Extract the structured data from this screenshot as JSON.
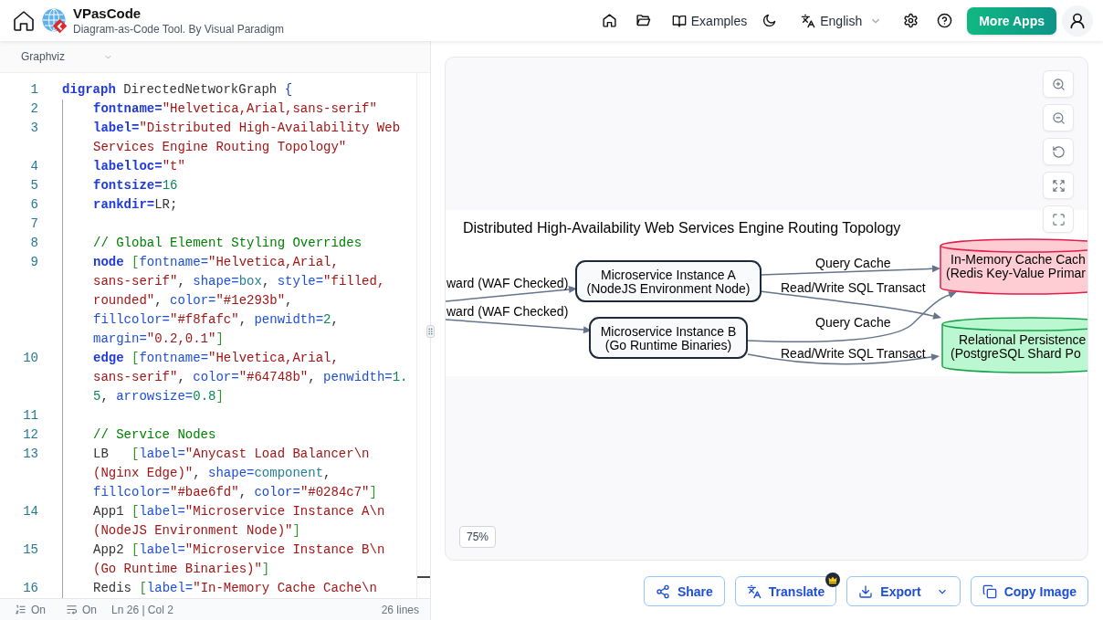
{
  "header": {
    "app_name": "VPasCode",
    "tagline": "Diagram-as-Code Tool. By Visual Paradigm",
    "examples_label": "Examples",
    "language": "English",
    "more_apps_label": "More Apps"
  },
  "editor": {
    "language": "Graphviz",
    "lines": [
      {
        "number": "1",
        "indented": false,
        "tokens": [
          {
            "kind": "keyword",
            "text": "digraph"
          },
          {
            "kind": "plain",
            "text": " DirectedNetworkGraph "
          },
          {
            "kind": "brace",
            "text": "{"
          }
        ]
      },
      {
        "number": "2",
        "indented": true,
        "tokens": [
          {
            "kind": "property",
            "text": "fontname="
          },
          {
            "kind": "string",
            "text": "\"Helvetica,Arial,sans-serif\""
          }
        ]
      },
      {
        "number": "3",
        "indented": true,
        "tokens": [
          {
            "kind": "property",
            "text": "label="
          },
          {
            "kind": "string",
            "text": "\"Distributed High-Availability Web"
          },
          {
            "kind": "wrap"
          },
          {
            "kind": "string",
            "text": "Services Engine Routing Topology\""
          }
        ]
      },
      {
        "number": "4",
        "indented": true,
        "tokens": [
          {
            "kind": "property",
            "text": "labelloc="
          },
          {
            "kind": "string",
            "text": "\"t\""
          }
        ]
      },
      {
        "number": "5",
        "indented": true,
        "tokens": [
          {
            "kind": "property",
            "text": "fontsize="
          },
          {
            "kind": "number",
            "text": "16"
          }
        ]
      },
      {
        "number": "6",
        "indented": true,
        "tokens": [
          {
            "kind": "property",
            "text": "rankdir="
          },
          {
            "kind": "plain",
            "text": "LR;"
          }
        ]
      },
      {
        "number": "7",
        "indented": true
      },
      {
        "number": "8",
        "indented": true,
        "tokens": [
          {
            "kind": "comment",
            "text": "// Global Element Styling Overrides"
          }
        ]
      },
      {
        "number": "9",
        "indented": true,
        "tokens": [
          {
            "kind": "keyword",
            "text": "node "
          },
          {
            "kind": "bracket",
            "text": "["
          },
          {
            "kind": "attribute",
            "text": "fontname="
          },
          {
            "kind": "string",
            "text": "\"Helvetica,Arial,"
          },
          {
            "kind": "wrap"
          },
          {
            "kind": "string",
            "text": "sans-serif\""
          },
          {
            "kind": "plain",
            "text": ", "
          },
          {
            "kind": "attribute",
            "text": "shape="
          },
          {
            "kind": "value",
            "text": "box"
          },
          {
            "kind": "plain",
            "text": ", "
          },
          {
            "kind": "attribute",
            "text": "style="
          },
          {
            "kind": "string",
            "text": "\"filled,"
          },
          {
            "kind": "wrap"
          },
          {
            "kind": "string",
            "text": "rounded\""
          },
          {
            "kind": "plain",
            "text": ", "
          },
          {
            "kind": "attribute",
            "text": "color="
          },
          {
            "kind": "string",
            "text": "\"#1e293b\""
          },
          {
            "kind": "plain",
            "text": ","
          },
          {
            "kind": "wrap"
          },
          {
            "kind": "attribute",
            "text": "fillcolor="
          },
          {
            "kind": "string",
            "text": "\"#f8fafc\""
          },
          {
            "kind": "plain",
            "text": ", "
          },
          {
            "kind": "attribute",
            "text": "penwidth="
          },
          {
            "kind": "number",
            "text": "2"
          },
          {
            "kind": "plain",
            "text": ","
          },
          {
            "kind": "wrap"
          },
          {
            "kind": "attribute",
            "text": "margin="
          },
          {
            "kind": "string",
            "text": "\"0.2,0.1\""
          },
          {
            "kind": "bracket",
            "text": "]"
          }
        ]
      },
      {
        "number": "10",
        "indented": true,
        "tokens": [
          {
            "kind": "keyword",
            "text": "edge "
          },
          {
            "kind": "bracket",
            "text": "["
          },
          {
            "kind": "attribute",
            "text": "fontname="
          },
          {
            "kind": "string",
            "text": "\"Helvetica,Arial,"
          },
          {
            "kind": "wrap"
          },
          {
            "kind": "string",
            "text": "sans-serif\""
          },
          {
            "kind": "plain",
            "text": ", "
          },
          {
            "kind": "attribute",
            "text": "color="
          },
          {
            "kind": "string",
            "text": "\"#64748b\""
          },
          {
            "kind": "plain",
            "text": ", "
          },
          {
            "kind": "attribute",
            "text": "penwidth="
          },
          {
            "kind": "number",
            "text": "1."
          },
          {
            "kind": "wrap"
          },
          {
            "kind": "number",
            "text": "5"
          },
          {
            "kind": "plain",
            "text": ", "
          },
          {
            "kind": "attribute",
            "text": "arrowsize="
          },
          {
            "kind": "number",
            "text": "0.8"
          },
          {
            "kind": "bracket",
            "text": "]"
          }
        ]
      },
      {
        "number": "11",
        "indented": true
      },
      {
        "number": "12",
        "indented": true,
        "tokens": [
          {
            "kind": "comment",
            "text": "// Service Nodes"
          }
        ]
      },
      {
        "number": "13",
        "indented": true,
        "tokens": [
          {
            "kind": "plain",
            "text": "LB   "
          },
          {
            "kind": "bracket",
            "text": "["
          },
          {
            "kind": "attribute",
            "text": "label="
          },
          {
            "kind": "string",
            "text": "\"Anycast Load Balancer\\n"
          },
          {
            "kind": "wrap"
          },
          {
            "kind": "string",
            "text": "(Nginx Edge)\""
          },
          {
            "kind": "plain",
            "text": ", "
          },
          {
            "kind": "attribute",
            "text": "shape="
          },
          {
            "kind": "value",
            "text": "component"
          },
          {
            "kind": "plain",
            "text": ","
          },
          {
            "kind": "wrap"
          },
          {
            "kind": "attribute",
            "text": "fillcolor="
          },
          {
            "kind": "string",
            "text": "\"#bae6fd\""
          },
          {
            "kind": "plain",
            "text": ", "
          },
          {
            "kind": "attribute",
            "text": "color="
          },
          {
            "kind": "string",
            "text": "\"#0284c7\""
          },
          {
            "kind": "bracket",
            "text": "]"
          }
        ]
      },
      {
        "number": "14",
        "indented": true,
        "tokens": [
          {
            "kind": "plain",
            "text": "App1 "
          },
          {
            "kind": "bracket",
            "text": "["
          },
          {
            "kind": "attribute",
            "text": "label="
          },
          {
            "kind": "string",
            "text": "\"Microservice Instance A\\n"
          },
          {
            "kind": "wrap"
          },
          {
            "kind": "string",
            "text": "(NodeJS Environment Node)\""
          },
          {
            "kind": "bracket",
            "text": "]"
          }
        ]
      },
      {
        "number": "15",
        "indented": true,
        "tokens": [
          {
            "kind": "plain",
            "text": "App2 "
          },
          {
            "kind": "bracket",
            "text": "["
          },
          {
            "kind": "attribute",
            "text": "label="
          },
          {
            "kind": "string",
            "text": "\"Microservice Instance B\\n"
          },
          {
            "kind": "wrap"
          },
          {
            "kind": "string",
            "text": "(Go Runtime Binaries)\""
          },
          {
            "kind": "bracket",
            "text": "]"
          }
        ]
      },
      {
        "number": "16",
        "indented": true,
        "tokens": [
          {
            "kind": "plain",
            "text": "Redis "
          },
          {
            "kind": "bracket",
            "text": "["
          },
          {
            "kind": "attribute",
            "text": "label="
          },
          {
            "kind": "string",
            "text": "\"In-Memory Cache Cache\\n"
          }
        ]
      }
    ],
    "status": {
      "line_numbers": "On",
      "word_wrap": "On",
      "cursor": "Ln 26 | Col 2",
      "line_count": "26 lines"
    }
  },
  "preview": {
    "zoom": "75%",
    "diagram": {
      "title": "Distributed High-Availability Web Services Engine Routing Topology",
      "nodes": [
        {
          "kind": "box",
          "color": "#f8fafc",
          "lines": [
            "Microservice Instance A",
            "(NodeJS Environment Node)"
          ]
        },
        {
          "kind": "box",
          "color": "#f8fafc",
          "lines": [
            "Microservice Instance B",
            "(Go Runtime Binaries)"
          ]
        },
        {
          "kind": "cylinder",
          "color": "#fecdd3",
          "lines": [
            "In-Memory Cache Cach",
            "(Redis Key-Value Primar"
          ]
        },
        {
          "kind": "cylinder",
          "color": "#bbf7d0",
          "lines": [
            "Relational Persistence",
            "(PostgreSQL Shard Po"
          ]
        }
      ],
      "edges": [
        {
          "label": "ward (WAF Checked)"
        },
        {
          "label": "ward (WAF Checked)"
        },
        {
          "label": "Query Cache"
        },
        {
          "label": "Read/Write SQL Transact"
        },
        {
          "label": "Query Cache"
        },
        {
          "label": "Read/Write SQL Transact"
        }
      ]
    }
  },
  "actions": [
    {
      "kind": "share",
      "label": "Share",
      "premium": false,
      "menu": false
    },
    {
      "kind": "translate",
      "label": "Translate",
      "premium": true,
      "menu": false
    },
    {
      "kind": "export",
      "label": "Export",
      "premium": false,
      "menu": true
    },
    {
      "kind": "copy",
      "label": "Copy Image",
      "premium": false,
      "menu": false
    }
  ]
}
